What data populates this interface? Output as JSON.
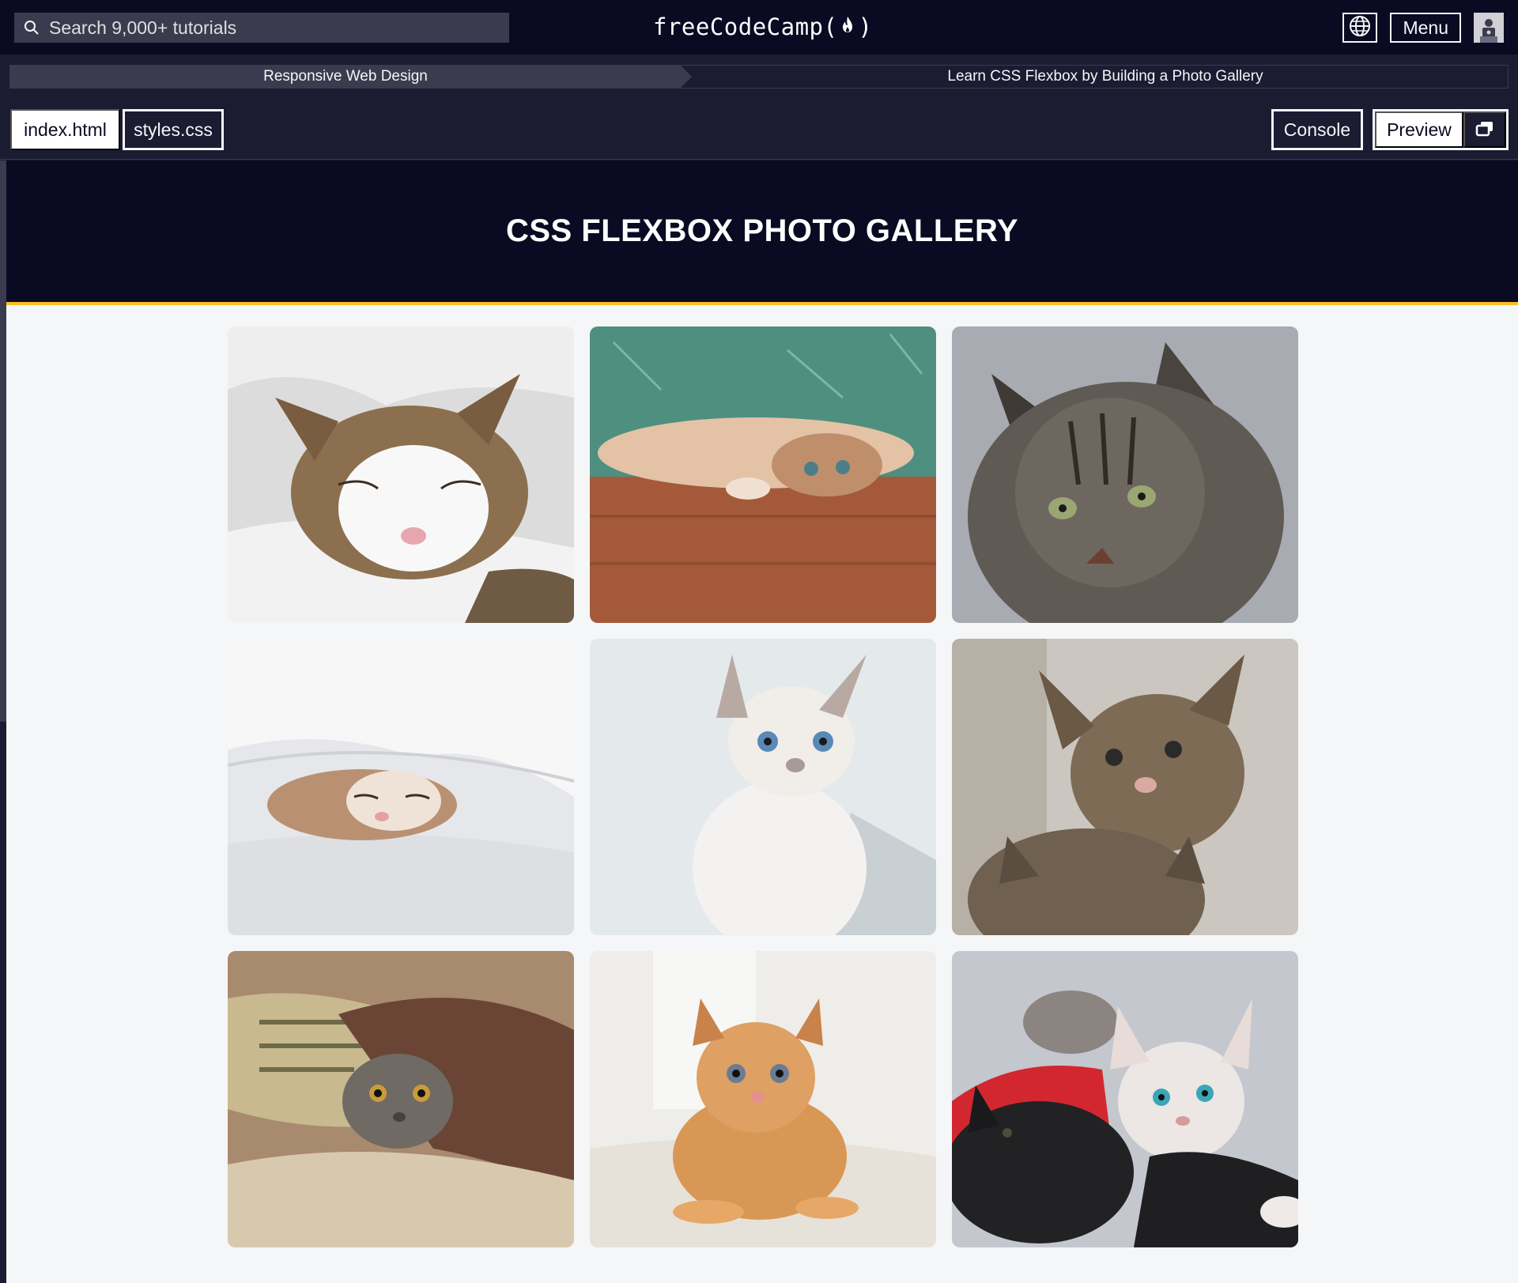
{
  "topnav": {
    "search_placeholder": "Search 9,000+ tutorials",
    "logo_left": "freeCodeCamp(",
    "logo_right": ")",
    "menu_label": "Menu"
  },
  "breadcrumb": {
    "superblock": "Responsive Web Design",
    "block": "Learn CSS Flexbox by Building a Photo Gallery"
  },
  "tabs": {
    "index": "index.html",
    "styles": "styles.css",
    "console": "Console",
    "preview": "Preview"
  },
  "preview": {
    "title": "CSS FLEXBOX PHOTO GALLERY",
    "photos": [
      {
        "name": "cat-sleeping-white-blanket",
        "bg": "#d8d8d8",
        "fur": "#8a6d4d"
      },
      {
        "name": "cat-lying-wooden-floor",
        "bg": "#4d8c7d",
        "fur": "#c89068"
      },
      {
        "name": "tabby-cat-portrait",
        "bg": "#a7aab0",
        "fur": "#5e5a55"
      },
      {
        "name": "cat-under-white-sheet",
        "bg": "#e8e8ea",
        "fur": "#b08c6a"
      },
      {
        "name": "white-kitten-blue-eyes",
        "bg": "#dfe5e8",
        "fur": "#ece8e4"
      },
      {
        "name": "tabby-kittens",
        "bg": "#c9c4bd",
        "fur": "#7b6852"
      },
      {
        "name": "cat-under-blanket-pillow",
        "bg": "#a98a6e",
        "fur": "#6d6760"
      },
      {
        "name": "orange-kitten",
        "bg": "#ecebe7",
        "fur": "#d99a57"
      },
      {
        "name": "kittens-black-and-white",
        "bg": "#c5c7cc",
        "fur": "#e9e5e3"
      }
    ]
  },
  "colors": {
    "nav_bg": "#0a0a23",
    "panel_bg": "#1b1b32",
    "accent_border": "#fcbe24",
    "gallery_bg": "#f5f6f7"
  }
}
